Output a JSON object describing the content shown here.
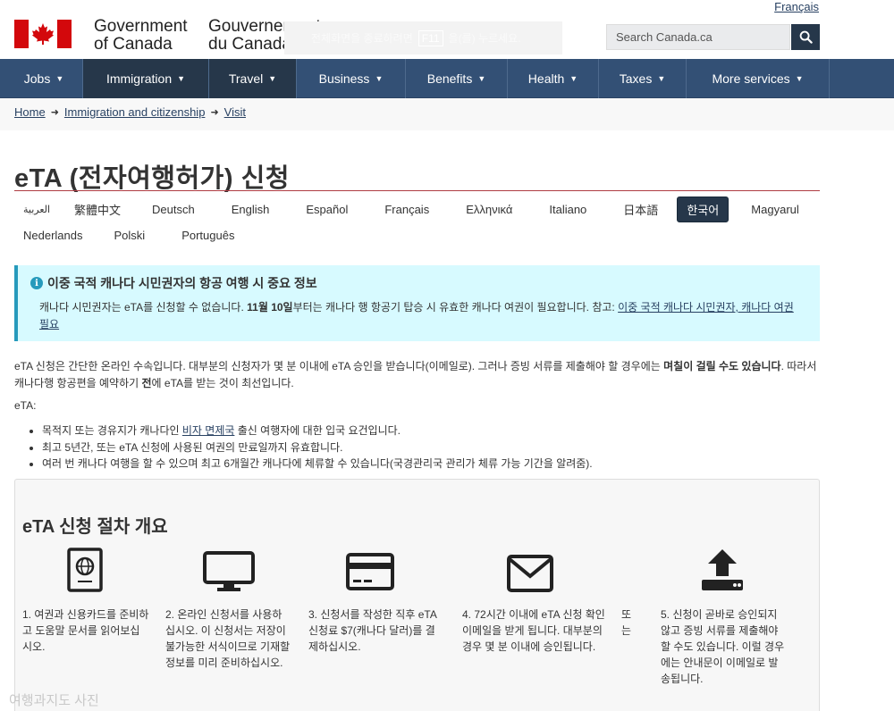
{
  "header": {
    "language_toggle": "Français",
    "signature_en": [
      "Government",
      "of Canada"
    ],
    "signature_fr": [
      "Gouvernement",
      "du Canada"
    ],
    "keyboard_hint": {
      "before": "전체화면을 종료하려면",
      "key": "F11",
      "after": "을(를) 누르세요."
    },
    "search": {
      "placeholder": "Search Canada.ca"
    }
  },
  "nav": {
    "items": [
      {
        "label": "Jobs"
      },
      {
        "label": "Immigration"
      },
      {
        "label": "Travel"
      },
      {
        "label": "Business"
      },
      {
        "label": "Benefits"
      },
      {
        "label": "Health"
      },
      {
        "label": "Taxes"
      },
      {
        "label": "More services"
      }
    ]
  },
  "breadcrumb": {
    "items": [
      "Home",
      "Immigration and citizenship",
      "Visit"
    ]
  },
  "page": {
    "title": "eTA (전자여행허가) 신청",
    "languages_row1": [
      "العربية",
      "繁體中文",
      "Deutsch",
      "English",
      "Español",
      "Français",
      "Ελληνικά",
      "Italiano",
      "日本語",
      "한국어",
      "Magyarul"
    ],
    "languages_row2": [
      "Nederlands",
      "Polski",
      "Português"
    ],
    "active_language": "한국어"
  },
  "alert": {
    "title": "이중 국적 캐나다 시민권자의 항공 여행 시 중요 정보",
    "text_before": "캐나다 시민권자는 eTA를 신청할 수 없습니다. ",
    "text_bold": "11월 10일",
    "text_after": "부터는 캐나다 행 항공기 탑승 시 유효한 캐나다 여권이 필요합니다. 참고: ",
    "link": "이중 국적 캐나다 시민권자, 캐나다 여권 필요"
  },
  "intro": {
    "p1_a": "eTA 신청은 간단한 온라인 수속입니다. 대부분의 신청자가 몇 분 이내에 eTA 승인을 받습니다(이메일로). 그러나 증빙 서류를 제출해야 할 경우에는 ",
    "p1_bold": "며칠이 걸릴 수도 있습니다",
    "p1_b": ". 따라서 캐나다행 항공편을 예약하기 ",
    "p1_bold2": "전",
    "p1_c": "에 eTA를 받는 것이 최선입니다.",
    "p2": "eTA:",
    "bullet1_a": "목적지 또는 경유지가 캐나다인 ",
    "bullet1_link": "비자 면제국",
    "bullet1_b": " 출신 여행자에 대한 입국 요건입니다.",
    "bullet2": "최고 5년간, 또는 eTA 신청에 사용된 여권의 만료일까지 유효합니다.",
    "bullet3": "여러 번 캐나다 여행을 할 수 있으며 최고 6개월간 캐나다에 체류할 수 있습니다(국경관리국 관리가 체류 가능 기간을 알려줌)."
  },
  "steps": {
    "heading": "eTA 신청 절차 개요",
    "items": [
      {
        "icon": "passport-icon",
        "text": "1. 여권과 신용카드를 준비하고 도움말 문서를 읽어보십시오."
      },
      {
        "icon": "monitor-icon",
        "text": "2. 온라인 신청서를 사용하십시오. 이 신청서는 저장이 불가능한 서식이므로 기재할 정보를 미리 준비하십시오."
      },
      {
        "icon": "credit-card-icon",
        "text": "3. 신청서를 작성한 직후 eTA 신청료 $7(캐나다 달러)를 결제하십시오."
      },
      {
        "icon": "envelope-icon",
        "text": "4. 72시간 이내에 eTA 신청 확인 이메일을 받게 됩니다. 대부분의 경우 몇 분 이내에 승인됩니다."
      },
      {
        "icon": "upload-icon",
        "text": "5. 신청이 곧바로 승인되지 않고 증빙 서류를 제출해야 할 수도 있습니다. 이럴 경우에는 안내문이 이메일로 발송됩니다."
      }
    ],
    "or_label": "또는"
  },
  "watermark": "여행과지도 사진",
  "colors": {
    "nav": "#335075",
    "nav_dark": "#26374a",
    "flag_red": "#d3080c",
    "alert_bg": "#d7faff",
    "title_rule": "#af3c43"
  }
}
